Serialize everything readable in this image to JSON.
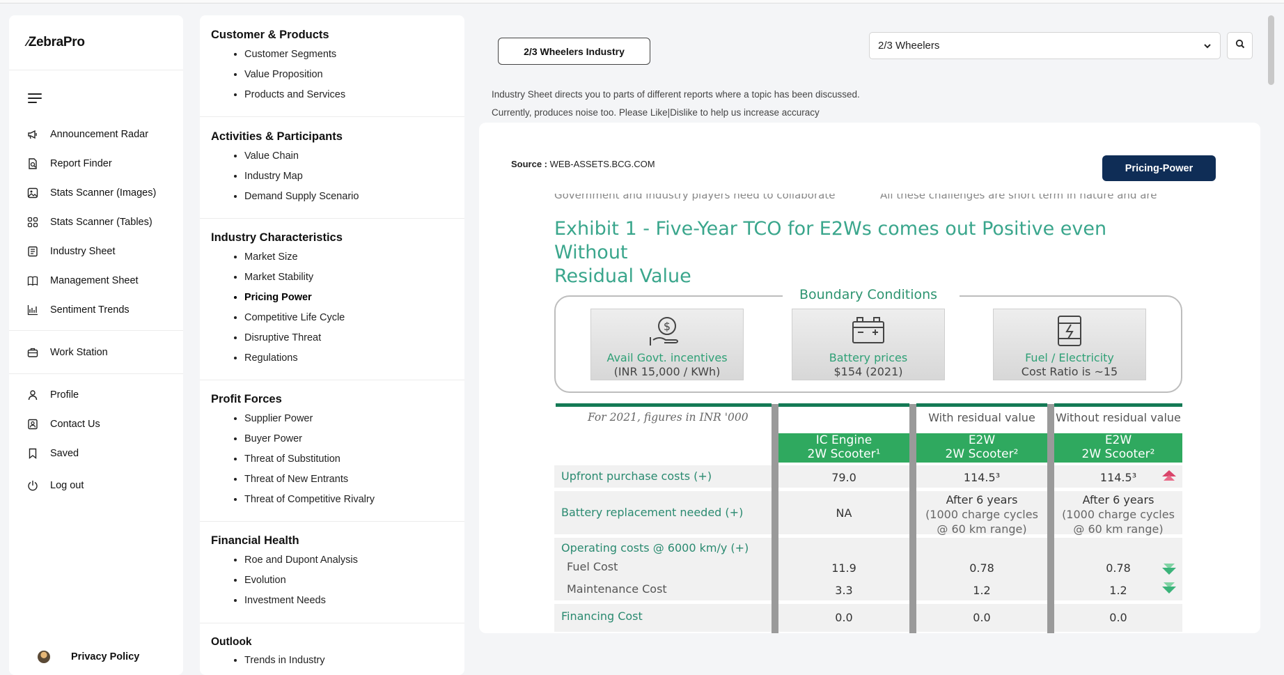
{
  "app": {
    "logo_name": "ZebraPro"
  },
  "sidebar": {
    "items": [
      {
        "label": "Announcement Radar",
        "icon": "megaphone-icon"
      },
      {
        "label": "Report Finder",
        "icon": "document-search-icon"
      },
      {
        "label": "Stats Scanner (Images)",
        "icon": "image-icon"
      },
      {
        "label": "Stats Scanner (Tables)",
        "icon": "grid-icon"
      },
      {
        "label": "Industry Sheet",
        "icon": "sheet-icon"
      },
      {
        "label": "Management Sheet",
        "icon": "book-icon"
      },
      {
        "label": "Sentiment Trends",
        "icon": "chart-icon"
      }
    ],
    "workstation": {
      "label": "Work Station",
      "icon": "briefcase-icon"
    },
    "account": [
      {
        "label": "Profile",
        "icon": "person-icon"
      },
      {
        "label": "Contact Us",
        "icon": "contact-icon"
      },
      {
        "label": "Saved",
        "icon": "bookmark-icon"
      },
      {
        "label": "Log out",
        "icon": "power-icon"
      }
    ],
    "privacy": "Privacy Policy"
  },
  "topics": [
    {
      "title": "Customer & Products",
      "items": [
        "Customer Segments",
        "Value Proposition",
        "Products and Services"
      ]
    },
    {
      "title": "Activities & Participants",
      "items": [
        "Value Chain",
        "Industry Map",
        "Demand Supply Scenario"
      ]
    },
    {
      "title": "Industry Characteristics",
      "items": [
        "Market Size",
        "Market Stability",
        "Pricing Power",
        "Competitive Life Cycle",
        "Disruptive Threat",
        "Regulations"
      ]
    },
    {
      "title": "Profit Forces",
      "items": [
        "Supplier Power",
        "Buyer Power",
        "Threat of Substitution",
        "Threat of New Entrants",
        "Threat of Competitive Rivalry"
      ]
    },
    {
      "title": "Financial Health",
      "items": [
        "Roe and Dupont Analysis",
        "Evolution",
        "Investment Needs"
      ]
    },
    {
      "title": "Outlook",
      "items": [
        "Trends in Industry"
      ]
    }
  ],
  "active_topic": "Pricing Power",
  "main": {
    "industry_button": "2/3 Wheelers Industry",
    "select_value": "2/3 Wheelers",
    "info_line_1": "Industry Sheet directs you to parts of different reports where a topic has been discussed.",
    "info_line_2": "Currently, produces noise too. Please Like|Dislike to help us increase accuracy",
    "source_label": "Source :",
    "source_value": "WEB-ASSETS.BCG.COM",
    "tag_button": "Pricing-Power"
  },
  "exhibit": {
    "cut_left": "Government and industry players need to collaborate",
    "cut_right": "All these challenges are short term in nature and are",
    "title_line1": "Exhibit 1 - Five-Year TCO for E2Ws comes out Positive even Without",
    "title_line2": "Residual Value",
    "boundary_title": "Boundary Conditions",
    "tiles": [
      {
        "line1": "Avail Govt. incentives",
        "line2": "(INR 15,000 / KWh)"
      },
      {
        "line1": "Battery prices",
        "line2": "$154 (2021)"
      },
      {
        "line1": "Fuel / Electricity",
        "line2": "Cost Ratio is ~15"
      }
    ],
    "figures_note": "For 2021, figures in INR '000",
    "subheaders": [
      "With residual value",
      "Without residual value"
    ],
    "columns": [
      {
        "line1": "IC Engine",
        "line2": "2W Scooter¹"
      },
      {
        "line1": "E2W",
        "line2": "2W Scooter²"
      },
      {
        "line1": "E2W",
        "line2": "2W Scooter²"
      }
    ],
    "rows": {
      "upfront": {
        "label": "Upfront purchase costs (+)",
        "values": [
          "79.0",
          "114.5³",
          "114.5³"
        ]
      },
      "battery": {
        "label": "Battery replacement needed (+)",
        "ic": "NA",
        "line1": "After 6 years",
        "line2": "(1000 charge cycles",
        "line3": "@ 60 km range)"
      },
      "operating": {
        "label": "Operating costs @ 6000 km/y (+)"
      },
      "fuel": {
        "label": "Fuel Cost",
        "values": [
          "11.9",
          "0.78",
          "0.78"
        ]
      },
      "maintenance": {
        "label": "Maintenance Cost",
        "values": [
          "3.3",
          "1.2",
          "1.2"
        ]
      },
      "financing": {
        "label": "Financing Cost",
        "values": [
          "0.0",
          "0.0",
          "0.0"
        ]
      }
    },
    "colors": {
      "green_text": "#2a8a70",
      "green_header": "#2fa95f",
      "up_arrow": "#d9456a",
      "down_arrow": "#3bb37a"
    }
  }
}
